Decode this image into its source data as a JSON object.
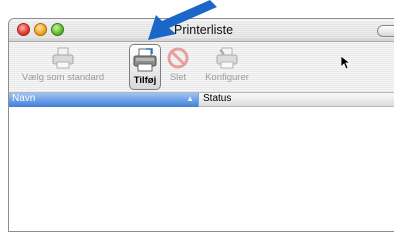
{
  "window": {
    "title": "Printerliste"
  },
  "toolbar": {
    "default_label": "Vælg som standard",
    "add_label": "Tilføj",
    "delete_label": "Slet",
    "configure_label": "Konfigurer"
  },
  "table": {
    "columns": [
      "Navn",
      "Status"
    ],
    "sort_indicator": "▲",
    "rows": []
  },
  "colors": {
    "header_selected": "#3f7fd6",
    "arrow": "#1b66c9"
  },
  "icons": [
    "printer-icon",
    "add-printer-icon",
    "delete-icon",
    "configure-printer-icon",
    "callout-arrow-icon",
    "mouse-cursor-icon"
  ]
}
